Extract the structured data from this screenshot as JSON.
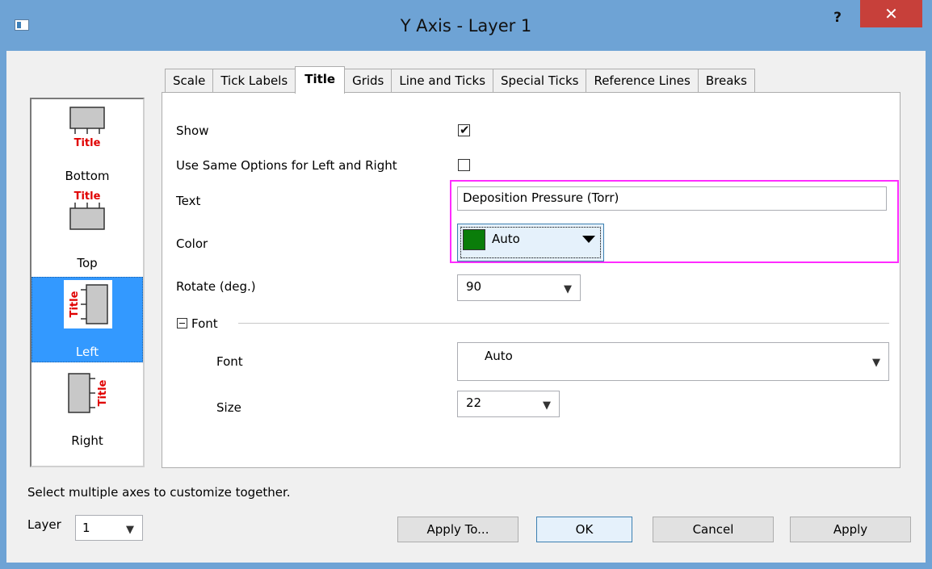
{
  "window": {
    "title": "Y Axis - Layer 1",
    "help_label": "?",
    "close_label": "✕"
  },
  "tabs": [
    {
      "label": "Scale"
    },
    {
      "label": "Tick Labels"
    },
    {
      "label": "Title"
    },
    {
      "label": "Grids"
    },
    {
      "label": "Line and Ticks"
    },
    {
      "label": "Special Ticks"
    },
    {
      "label": "Reference Lines"
    },
    {
      "label": "Breaks"
    }
  ],
  "active_tab": "Title",
  "axes": [
    {
      "label": "Bottom",
      "icon_text": "Title"
    },
    {
      "label": "Top",
      "icon_text": "Title"
    },
    {
      "label": "Left",
      "icon_text": "Title",
      "selected": true
    },
    {
      "label": "Right",
      "icon_text": "Title"
    }
  ],
  "form": {
    "show_label": "Show",
    "show_checked": true,
    "same_options_label": "Use Same Options for Left and Right",
    "same_options_checked": false,
    "text_label": "Text",
    "text_value": "Deposition Pressure (Torr)",
    "color_label": "Color",
    "color_value": "Auto",
    "color_swatch": "#0a7d0a",
    "rotate_label": "Rotate (deg.)",
    "rotate_value": "90",
    "font_group_label": "Font",
    "font_label": "Font",
    "font_value": "Auto",
    "size_label": "Size",
    "size_value": "22"
  },
  "hint": "Select multiple axes to customize together.",
  "layer": {
    "label": "Layer",
    "value": "1"
  },
  "buttons": {
    "apply_to": "Apply To...",
    "ok": "OK",
    "cancel": "Cancel",
    "apply": "Apply"
  },
  "colors": {
    "highlight": "#ff2bff",
    "selection": "#3399ff",
    "icon_text": "#e00000"
  }
}
